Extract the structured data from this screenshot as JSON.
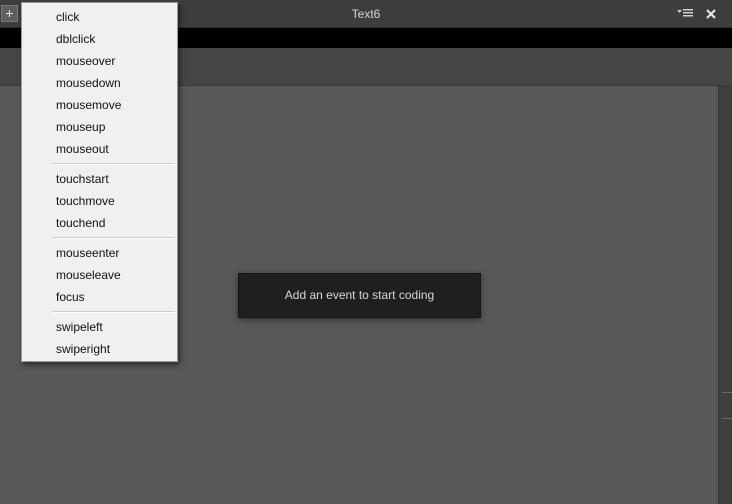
{
  "window": {
    "title": "Text6"
  },
  "titlebar": {
    "add_icon": "plus-icon",
    "menu_icon": "menu-list-icon",
    "close_icon": "close-icon"
  },
  "canvas": {
    "hint": "Add an event to start coding"
  },
  "event_menu": {
    "groups": [
      [
        "click",
        "dblclick",
        "mouseover",
        "mousedown",
        "mousemove",
        "mouseup",
        "mouseout"
      ],
      [
        "touchstart",
        "touchmove",
        "touchend"
      ],
      [
        "mouseenter",
        "mouseleave",
        "focus"
      ],
      [
        "swipeleft",
        "swiperight"
      ]
    ]
  },
  "colors": {
    "titlebar": "#3d3d3d",
    "canvas": "#585858",
    "hint_background": "#1f1f1f",
    "menu_background": "#f0f0f0"
  }
}
